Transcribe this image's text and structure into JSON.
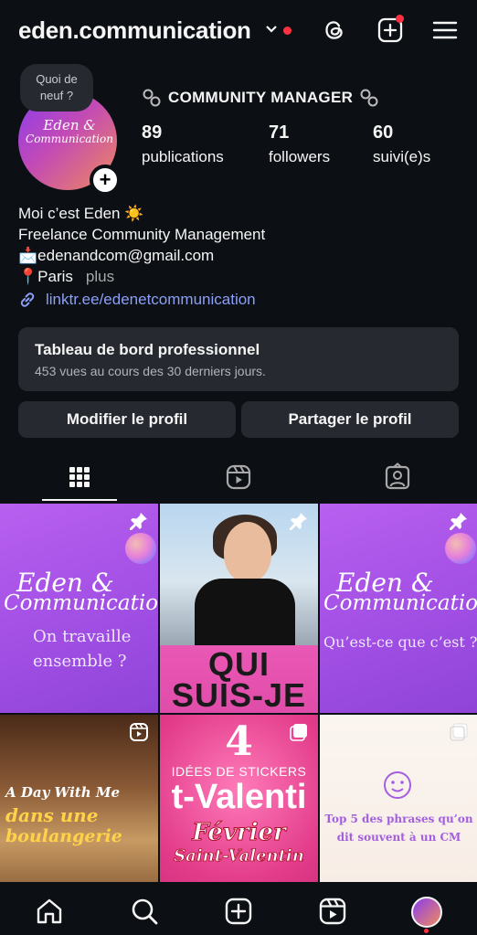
{
  "header": {
    "username": "eden.communication",
    "icons": [
      "chevron-down-icon",
      "threads-icon",
      "new-post-icon",
      "menu-icon"
    ]
  },
  "note": {
    "text_line1": "Quoi de",
    "text_line2": "neuf ?"
  },
  "avatar": {
    "line1": "Eden &",
    "line2": "Communication"
  },
  "profile": {
    "category": "COMMUNITY MANAGER",
    "stats": {
      "posts_count": "89",
      "posts_label": "publications",
      "followers_count": "71",
      "followers_label": "followers",
      "following_count": "60",
      "following_label": "suivi(e)s"
    },
    "bio": {
      "line1": "Moi c’est Eden ☀️",
      "line2": "Freelance Community Management",
      "line3": "📩edenandcom@gmail.com",
      "line4": "📍Paris",
      "more": "plus"
    },
    "link": "linktr.ee/edenetcommunication"
  },
  "dashboard": {
    "title": "Tableau de bord professionnel",
    "subtitle": "453 vues au cours des 30 derniers jours."
  },
  "buttons": {
    "edit": "Modifier le profil",
    "share": "Partager le profil"
  },
  "tabs": [
    "grid-icon",
    "reels-icon",
    "tagged-icon"
  ],
  "posts": {
    "p1": {
      "brand1": "Eden &",
      "brand2": "Communication",
      "caption1": "On travaille",
      "caption2": "ensemble ?"
    },
    "p2": {
      "line1": "QUI",
      "line2": "SUIS-JE"
    },
    "p3": {
      "brand1": "Eden &",
      "brand2": "Communication",
      "caption": "Qu’est-ce que c’est ?"
    },
    "p4": {
      "line1": "A Day With Me",
      "line2": "dans une",
      "line3": "boulangerie"
    },
    "p5": {
      "num": "4",
      "line1": "IDÉES DE STICKERS",
      "line2": "t-Valenti",
      "line3": "Février",
      "line4": "Saint-Valentin"
    },
    "p6": {
      "line1": "Top 5 des phrases qu’on",
      "line2": "dit souvent à un CM"
    }
  },
  "nav": [
    "home-icon",
    "search-icon",
    "create-icon",
    "reels-icon",
    "profile-avatar"
  ],
  "colors": {
    "background": "#0c1014",
    "surface": "#262a30",
    "link": "#8c9ff7",
    "notification": "#ff3040"
  }
}
